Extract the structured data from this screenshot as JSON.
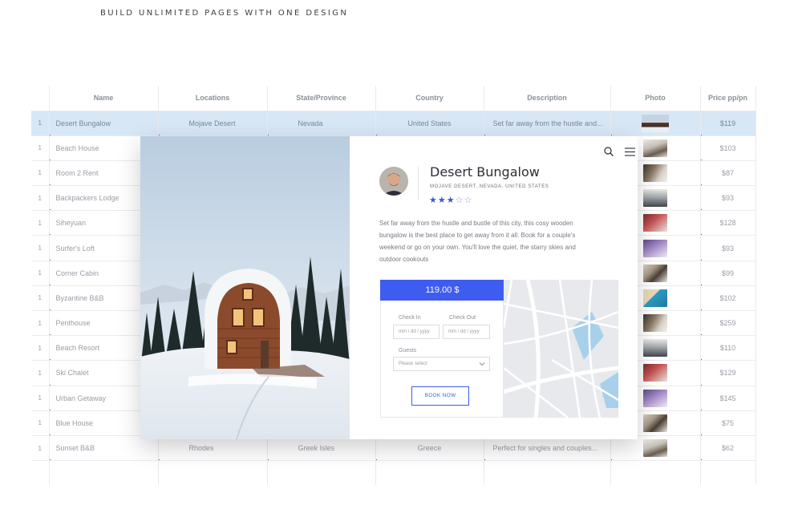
{
  "headline": "BUILD UNLIMITED PAGES WITH ONE DESIGN",
  "table": {
    "columns": [
      "",
      "Name",
      "Locations",
      "State/Province",
      "Country",
      "Description",
      "Photo",
      "Price pp/pn"
    ],
    "rows": [
      {
        "num": "1",
        "name": "Desert Bungalow",
        "location": "Mojave Desert",
        "state": "Nevada",
        "country": "United States",
        "description": "Set far away from the hustle and...",
        "price": "$119",
        "photo": "cabin-photo",
        "selected": true
      },
      {
        "num": "1",
        "name": "Beach House",
        "location": "",
        "state": "",
        "country": "",
        "description": "",
        "price": "$103",
        "photo": "room-photo"
      },
      {
        "num": "1",
        "name": "Room 2 Rent",
        "location": "",
        "state": "",
        "country": "",
        "description": "",
        "price": "$87",
        "photo": "room-photo"
      },
      {
        "num": "1",
        "name": "Backpackers Lodge",
        "location": "",
        "state": "",
        "country": "",
        "description": "",
        "price": "$93",
        "photo": "room-photo"
      },
      {
        "num": "1",
        "name": "Siheyuan",
        "location": "",
        "state": "",
        "country": "",
        "description": "",
        "price": "$128",
        "photo": "room-photo"
      },
      {
        "num": "1",
        "name": "Surfer's Loft",
        "location": "",
        "state": "",
        "country": "",
        "description": "",
        "price": "$93",
        "photo": "room-photo"
      },
      {
        "num": "1",
        "name": "Corner Cabin",
        "location": "",
        "state": "",
        "country": "",
        "description": "",
        "price": "$99",
        "photo": "room-photo"
      },
      {
        "num": "1",
        "name": "Byzantine B&B",
        "location": "",
        "state": "",
        "country": "",
        "description": "",
        "price": "$102",
        "photo": "pool-photo"
      },
      {
        "num": "1",
        "name": "Penthouse",
        "location": "",
        "state": "",
        "country": "",
        "description": "",
        "price": "$259",
        "photo": "room-photo"
      },
      {
        "num": "1",
        "name": "Beach Resort",
        "location": "",
        "state": "",
        "country": "",
        "description": "",
        "price": "$110",
        "photo": "room-photo"
      },
      {
        "num": "1",
        "name": "Ski Chalet",
        "location": "",
        "state": "",
        "country": "",
        "description": "",
        "price": "$129",
        "photo": "room-photo"
      },
      {
        "num": "1",
        "name": "Urban Getaway",
        "location": "",
        "state": "",
        "country": "",
        "description": "",
        "price": "$145",
        "photo": "room-photo"
      },
      {
        "num": "1",
        "name": "Blue House",
        "location": "",
        "state": "",
        "country": "",
        "description": "",
        "price": "$75",
        "photo": "room-photo"
      },
      {
        "num": "1",
        "name": "Sunset B&B",
        "location": "Rhodes",
        "state": "Greek Isles",
        "country": "Greece",
        "description": "Perfect for singles and couples...",
        "price": "$62",
        "photo": "room-photo"
      }
    ]
  },
  "card": {
    "title": "Desert Bungalow",
    "subtitle": "MOJAVE DESERT, NEVADA, UNITED STATES",
    "rating": {
      "value": 3,
      "max": 5
    },
    "description": "Set far away from the hustle and bustle of this city, this cosy wooden bungalow is the best place to get away from it all. Book for a couple's weekend or go on your own. You'll love the quiet, the starry skies and outdoor cookouts",
    "price": "119.00  $",
    "check_in_label": "Check In",
    "check_out_label": "Check Out",
    "date_placeholder": "mm / dd / yyyy",
    "guests_label": "Guests",
    "guests_placeholder": "Please select",
    "book_label": "BOOK NOW"
  },
  "colors": {
    "accent": "#3f5cf0",
    "selected_row": "#d8e7f6",
    "star": "#3e58c8"
  },
  "icons": [
    "search-icon",
    "menu-icon",
    "chevron-down-icon",
    "star-icon"
  ]
}
